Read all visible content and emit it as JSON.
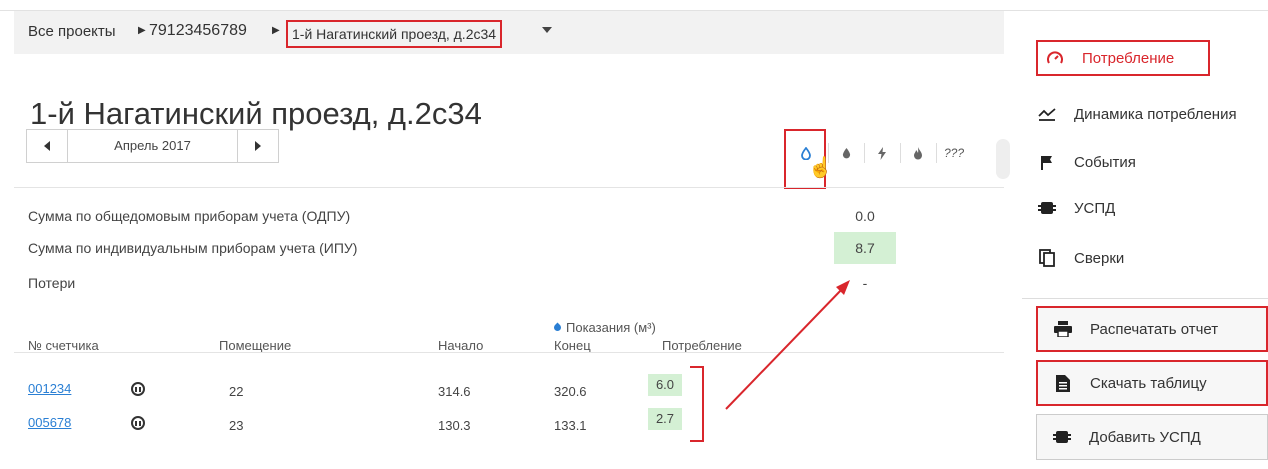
{
  "breadcrumb": {
    "all_projects": "Все проекты",
    "account": "79123456789",
    "current": "1-й Нагатинский проезд, д.2с34"
  },
  "page": {
    "title": "1-й Нагатинский проезд, д.2с34"
  },
  "period": {
    "label": "Апрель 2017"
  },
  "resources": {
    "buttons": [
      {
        "name": "water-drop-icon"
      },
      {
        "name": "drop-filled-icon"
      },
      {
        "name": "electricity-icon"
      },
      {
        "name": "fire-icon"
      },
      {
        "name": "unknown-resource-icon",
        "label": "???"
      }
    ]
  },
  "summary": {
    "odpu_label": "Сумма по общедомовым приборам учета (ОДПУ)",
    "odpu_value": "0.0",
    "ipu_label": "Сумма по индивидуальным приборам учета (ИПУ)",
    "ipu_value": "8.7",
    "losses_label": "Потери",
    "losses_value": "-"
  },
  "table": {
    "readings_header": "Показания (м³)",
    "headers": {
      "meter": "№ счетчика",
      "premises": "Помещение",
      "start": "Начало",
      "end": "Конец",
      "consumption": "Потребление"
    },
    "rows": [
      {
        "meter": "001234",
        "premises": "22",
        "start": "314.6",
        "end": "320.6",
        "consumption": "6.0"
      },
      {
        "meter": "005678",
        "premises": "23",
        "start": "130.3",
        "end": "133.1",
        "consumption": "2.7"
      }
    ]
  },
  "menu": {
    "consumption": "Потребление",
    "dynamics": "Динамика потребления",
    "events": "События",
    "uspd": "УСПД",
    "reconciliation": "Сверки",
    "print_report": "Распечатать отчет",
    "download_table": "Скачать таблицу",
    "add_uspd": "Добавить УСПД"
  },
  "colors": {
    "highlight_red": "#d9262c",
    "accent_blue": "#2a7fd4",
    "value_green_bg": "#d4f0d4"
  }
}
